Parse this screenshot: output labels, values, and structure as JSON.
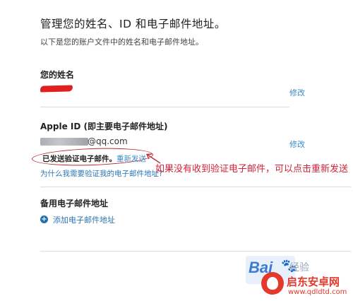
{
  "header": {
    "title": "管理您的姓名、ID 和电子邮件地址。",
    "subtitle": "以下是您的账户文件中的姓名和电子邮件地址。"
  },
  "name_section": {
    "heading": "您的姓名",
    "edit_label": "修改"
  },
  "apple_id_section": {
    "heading": "Apple ID (即主要电子邮件地址)",
    "email_suffix": "@qq.com",
    "edit_label": "修改",
    "sent_notice": "已发送验证电子邮件。",
    "resend_label": "重新发送",
    "why_link": "为什么我需要验证我的电子邮件地址?"
  },
  "backup_section": {
    "heading": "备用电子邮件地址",
    "add_label": "添加电子邮件地址"
  },
  "annotation": {
    "text": "如果没有收到验证电子邮件，可以点击重新发送"
  },
  "watermarks": {
    "baidu": "Bai",
    "baidu_suffix": "经验",
    "site_name": "启东安卓网",
    "site_url": "www.qdldtd.com"
  },
  "colors": {
    "link": "#3a8bc6",
    "annotation_red": "#d6223a",
    "scribble_red": "#e02020"
  }
}
